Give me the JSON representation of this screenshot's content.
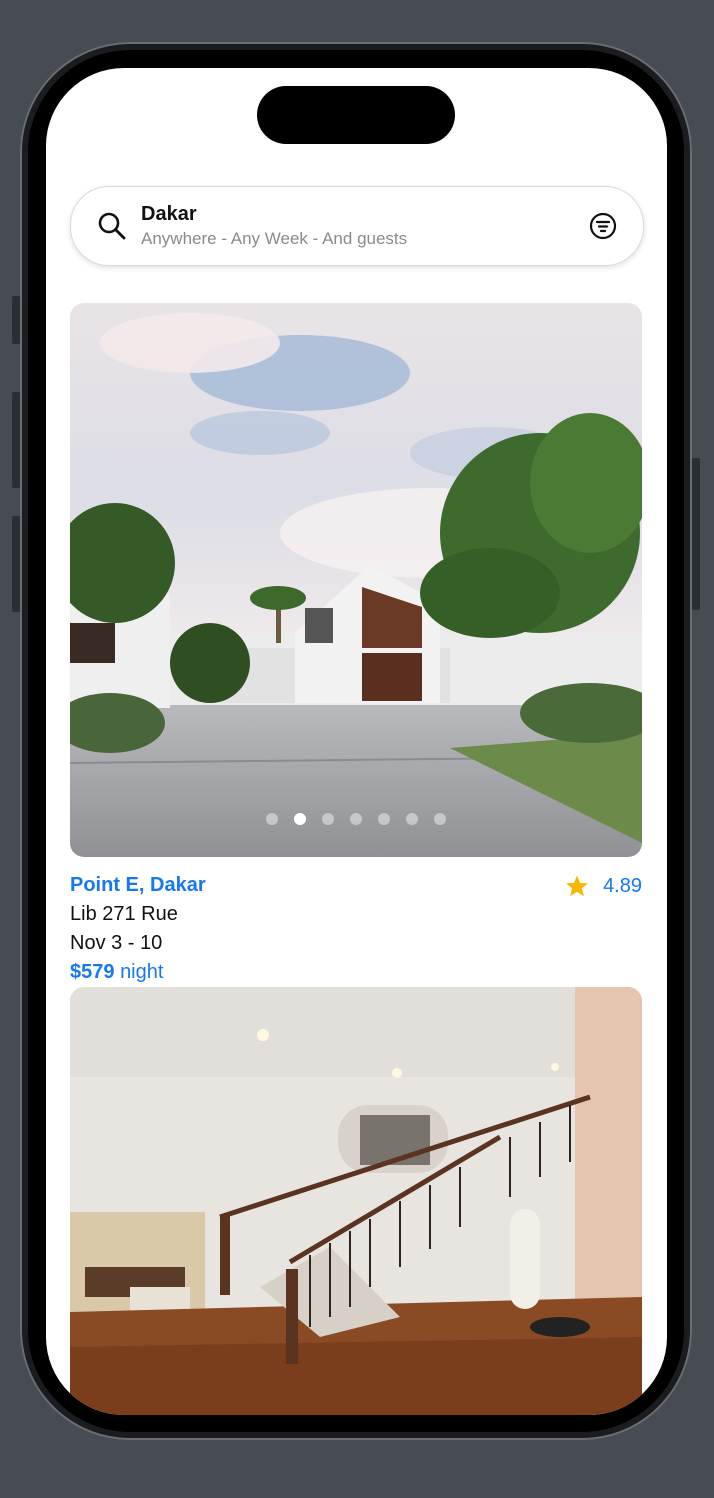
{
  "search": {
    "title": "Dakar",
    "subtitle": "Anywhere - Any Week - And guests",
    "icon": "search-icon",
    "filter_icon": "filter-icon"
  },
  "listings": [
    {
      "title": "Point E, Dakar",
      "rating": "4.89",
      "address": "Lib 271 Rue",
      "dates": "Nov 3 - 10",
      "price": "$579",
      "price_unit": "night",
      "photo_count": 7,
      "active_photo_index": 1,
      "photo_description": "modern white villa with driveway and trees"
    },
    {
      "photo_description": "interior staircase with wooden floor"
    }
  ],
  "colors": {
    "accent": "#1877f2",
    "star": "#f5b800",
    "background": "#474c53"
  }
}
